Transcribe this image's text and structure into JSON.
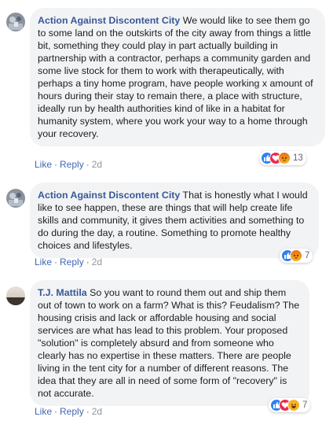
{
  "comments": [
    {
      "author": "Action Against Discontent City",
      "text": "We would like to see them go to some land on the outskirts of the city away from things a little bit, something they could play in part actually building in partnership with a contractor, perhaps a community garden and some live stock for them to work with therapeutically, with perhaps a tiny home program, have people working x amount of hours during their stay to remain there, a place with structure, ideally run by health authorities kind of like in a habitat for humanity system, where you work your way to a home through your recovery.",
      "like_label": "Like",
      "reply_label": "Reply",
      "separator": "·",
      "time": "2d",
      "reaction_icons": [
        "like-icon",
        "love-icon",
        "angry-icon"
      ],
      "reaction_count": "13"
    },
    {
      "author": "Action Against Discontent City",
      "text": "That is honestly what I would like to see happen, these are things that will help create life skills and community, it gives them activities and something to do during the day, a routine. Something to promote healthy choices and lifestyles.",
      "like_label": "Like",
      "reply_label": "Reply",
      "separator": "·",
      "time": "2d",
      "reaction_icons": [
        "like-icon",
        "angry-icon"
      ],
      "reaction_count": "7"
    },
    {
      "author": "T.J. Mattila",
      "text": "So you want to round them out and ship them out of town to work on a farm? What is this? Feudalism? The housing crisis and lack or affordable housing and social services are what has lead to this problem. Your proposed \"solution\" is completely absurd and from someone who clearly has no expertise in these matters. There are people living in the tent city for a number of different reasons. The idea that they are all in need of some form of \"recovery\" is not accurate.",
      "like_label": "Like",
      "reply_label": "Reply",
      "separator": "·",
      "time": "2d",
      "reaction_icons": [
        "like-icon",
        "love-icon",
        "haha-icon"
      ],
      "reaction_count": "7"
    }
  ],
  "colors": {
    "author": "#385898",
    "link": "#4267b2",
    "bubble": "#f2f3f5",
    "like": "#2e81f4",
    "love": "#f0284a",
    "angry": "#e9710f",
    "haha": "#f7b125"
  }
}
